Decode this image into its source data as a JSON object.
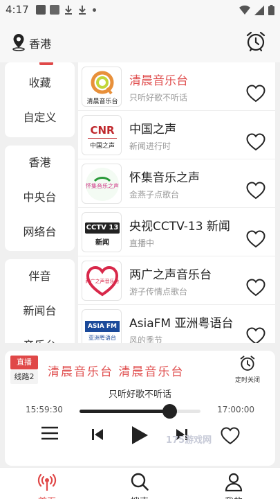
{
  "status": {
    "time": "4:17"
  },
  "header": {
    "location": "香港"
  },
  "left_menu": {
    "group1": [
      "收藏",
      "自定义"
    ],
    "group2": [
      "香港",
      "中央台",
      "网络台"
    ],
    "group3": [
      "伴音",
      "新闻台",
      "音乐台"
    ]
  },
  "stations": [
    {
      "title": "清晨音乐台",
      "subtitle": "只听好歌不听话",
      "logo_text": "清晨音乐台",
      "active": true
    },
    {
      "title": "中国之声",
      "subtitle": "新闻进行时",
      "logo_text": "CNR",
      "logo_sub": "中国之声"
    },
    {
      "title": "怀集音乐之声",
      "subtitle": "金燕子点歌台",
      "logo_text": "怀集音乐之声"
    },
    {
      "title": "央视CCTV-13 新闻",
      "subtitle": "直播中",
      "logo_text": "CCTV 13",
      "logo_sub": "新闻"
    },
    {
      "title": "两广之声音乐台",
      "subtitle": "游子传情点歌台",
      "logo_text": "两广之声音乐台"
    },
    {
      "title": "AsiaFM 亚洲粤语台",
      "subtitle": "风的季节",
      "logo_text": "ASIA FM",
      "logo_sub": "亚洲粤语台"
    }
  ],
  "player": {
    "badge_live": "直播",
    "badge_line": "线路2",
    "now_title": "清晨音乐台   清晨音乐台",
    "now_subtitle": "只听好歌不听话",
    "time_start": "15:59:30",
    "time_end": "17:00:00",
    "progress_fraction": 0.74,
    "timer_label": "定时关闭"
  },
  "watermark": "175游戏网",
  "nav": {
    "home": "首页",
    "search": "搜索",
    "mine": "我的"
  },
  "colors": {
    "accent": "#e04848",
    "active_text": "#e05050"
  }
}
